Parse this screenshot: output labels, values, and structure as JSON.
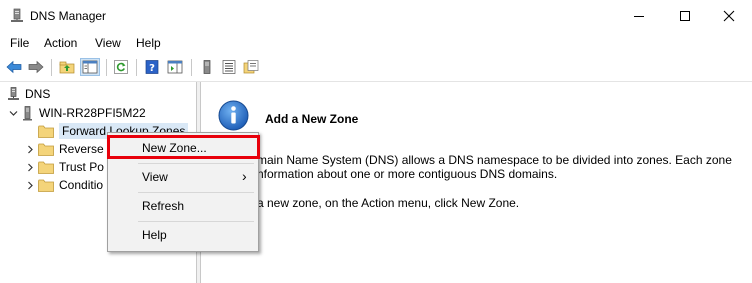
{
  "window": {
    "title": "DNS Manager",
    "minimize_glyph": "—",
    "maximize_glyph": "☐",
    "close_glyph": "✕"
  },
  "menu": [
    "File",
    "Action",
    "View",
    "Help"
  ],
  "toolbar": {
    "icons": [
      "back-arrow-icon",
      "forward-arrow-icon",
      "up-folder-icon",
      "show-hide-console-tree-icon",
      "refresh-icon",
      "help-icon",
      "show-hide-action-pane-icon",
      "server-icon",
      "list-icon",
      "properties-icon"
    ]
  },
  "tree": {
    "root": "DNS",
    "server": "WIN-RR28PFI5M22",
    "items": [
      "Forward Lookup Zones",
      "Reverse",
      "Trust Po",
      "Conditio"
    ]
  },
  "context_menu": {
    "items": [
      {
        "label": "New Zone...",
        "highlighted": true
      },
      {
        "label": "View",
        "submenu_glyph": "›"
      },
      {
        "label": "Refresh"
      },
      {
        "label": "Help"
      }
    ]
  },
  "content": {
    "heading": "Add a New Zone",
    "line1": "main Name System (DNS) allows a DNS namespace to be divided into zones. Each zone",
    "line2": "nformation about one or more contiguous DNS domains.",
    "line3": "a new zone, on the Action menu, click New Zone."
  },
  "colors": {
    "highlight_border": "#e8000b",
    "selection": "#d9e8f6",
    "folder": "#f4d47a"
  }
}
